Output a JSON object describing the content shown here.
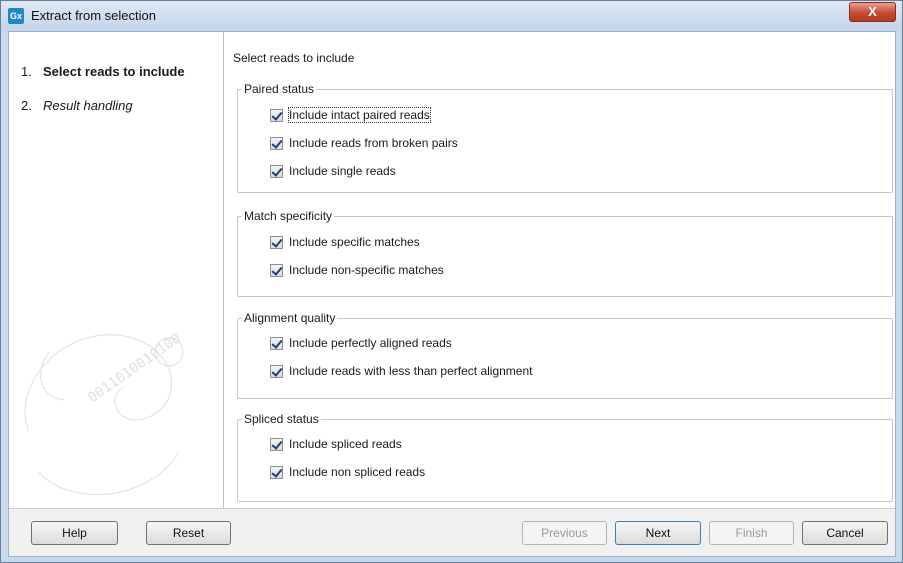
{
  "window": {
    "app_icon_text": "Gx",
    "title": "Extract from selection",
    "close_glyph": "X"
  },
  "steps": [
    {
      "number": "1.",
      "label": "Select reads to include",
      "active": true
    },
    {
      "number": "2.",
      "label": "Result handling",
      "active": false
    }
  ],
  "content": {
    "section_title": "Select reads to include",
    "groups": [
      {
        "label": "Paired status",
        "options": [
          {
            "label": "Include intact paired reads",
            "checked": true,
            "focused": true
          },
          {
            "label": "Include reads from broken pairs",
            "checked": true
          },
          {
            "label": "Include single reads",
            "checked": true
          }
        ]
      },
      {
        "label": "Match specificity",
        "options": [
          {
            "label": "Include specific matches",
            "checked": true
          },
          {
            "label": "Include non-specific matches",
            "checked": true
          }
        ]
      },
      {
        "label": "Alignment quality",
        "options": [
          {
            "label": "Include perfectly aligned reads",
            "checked": true
          },
          {
            "label": "Include reads with less than perfect alignment",
            "checked": true
          }
        ]
      },
      {
        "label": "Spliced status",
        "options": [
          {
            "label": "Include spliced reads",
            "checked": true
          },
          {
            "label": "Include non spliced reads",
            "checked": true
          }
        ]
      }
    ]
  },
  "buttons": {
    "help": "Help",
    "reset": "Reset",
    "previous": "Previous",
    "next": "Next",
    "finish": "Finish",
    "cancel": "Cancel"
  },
  "decoration": {
    "swirl_text": "0011010010100"
  },
  "colors": {
    "titlebar": "#c3d4e9",
    "close_button": "#c74a34",
    "app_icon": "#1f87c8",
    "checkmark": "#1f3f7a"
  }
}
